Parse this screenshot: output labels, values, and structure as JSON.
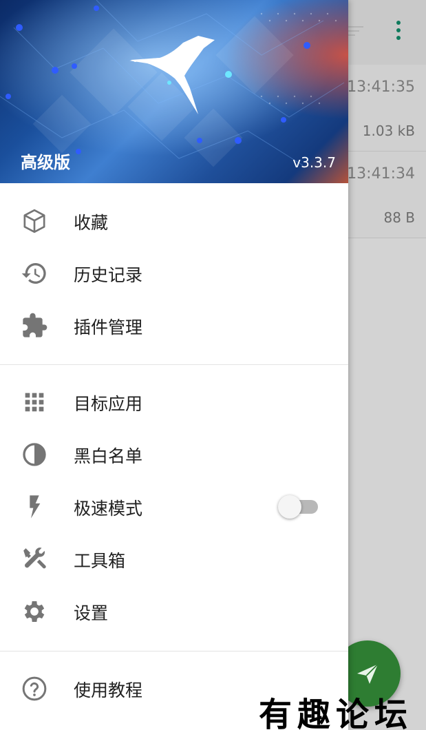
{
  "drawer": {
    "title": "高级版",
    "version": "v3.3.7",
    "sections": [
      [
        {
          "id": "favorites",
          "icon": "cube-icon",
          "label": "收藏"
        },
        {
          "id": "history",
          "icon": "history-icon",
          "label": "历史记录"
        },
        {
          "id": "plugins",
          "icon": "puzzle-icon",
          "label": "插件管理"
        }
      ],
      [
        {
          "id": "target-apps",
          "icon": "grid-icon",
          "label": "目标应用"
        },
        {
          "id": "blacklist",
          "icon": "contrast-icon",
          "label": "黑白名单"
        },
        {
          "id": "speed-mode",
          "icon": "lightning-icon",
          "label": "极速模式",
          "toggle": false
        },
        {
          "id": "toolbox",
          "icon": "tools-icon",
          "label": "工具箱"
        },
        {
          "id": "settings",
          "icon": "gear-icon",
          "label": "设置"
        }
      ],
      [
        {
          "id": "tutorial",
          "icon": "help-icon",
          "label": "使用教程"
        }
      ]
    ]
  },
  "background": {
    "rows": [
      {
        "time": "13:41:35",
        "size": "1.03 kB"
      },
      {
        "time": "13:41:34",
        "size": "88 B"
      }
    ]
  },
  "watermark": "有趣论坛",
  "colors": {
    "accent": "#0f7a5c",
    "fab": "#2e7d32",
    "icon": "#757575"
  }
}
